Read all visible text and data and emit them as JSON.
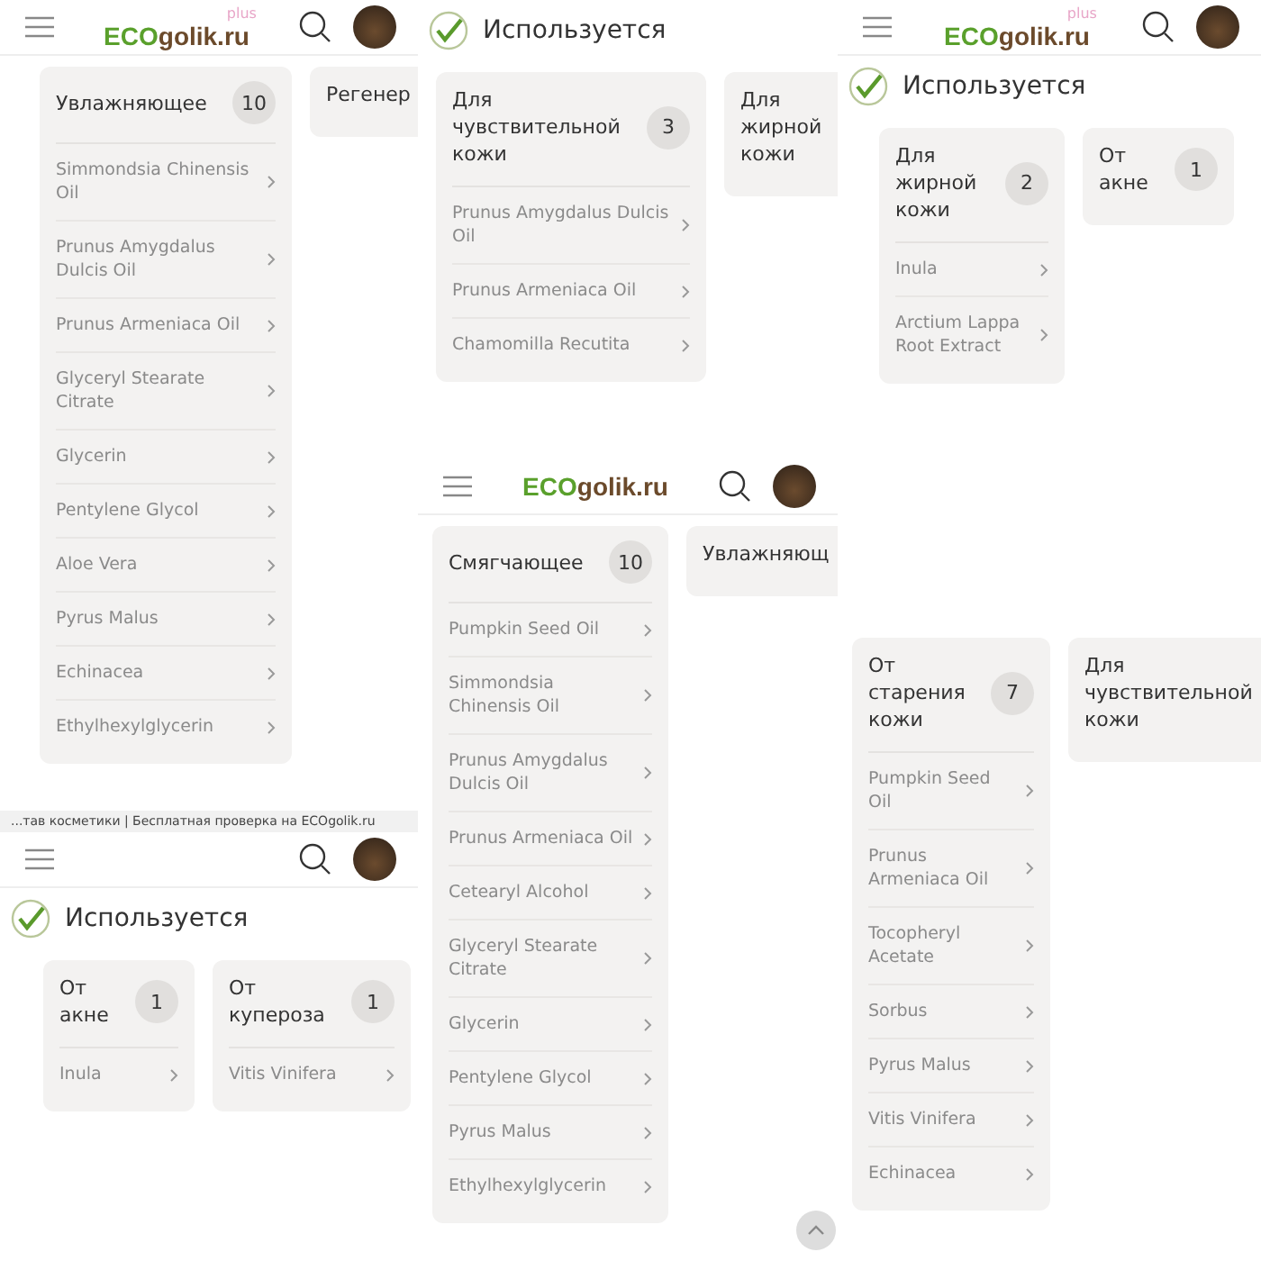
{
  "screenshots": [
    {
      "header": {
        "logo_main": "ECO",
        "logo_domain": "golik.ru",
        "logo_badge": "plus"
      },
      "cards": [
        {
          "title": "Увлажняющее",
          "count": "10",
          "items": [
            "Simmondsia Chinensis Oil",
            "Prunus Amygdalus Dulcis Oil",
            "Prunus Armeniaca Oil",
            "Glyceryl Stearate Citrate",
            "Glycerin",
            "Pentylene Glycol",
            "Aloe Vera",
            "Pyrus Malus",
            "Echinacea",
            "Ethylhexylglycerin"
          ]
        },
        {
          "title": "Регенер"
        }
      ]
    },
    {
      "used_label": "Используется",
      "cards": [
        {
          "title": "Для чувствительной кожи",
          "count": "3",
          "items": [
            "Prunus Amygdalus Dulcis Oil",
            "Prunus Armeniaca Oil",
            "Chamomilla Recutita"
          ]
        },
        {
          "title": "Для жирной кожи"
        }
      ]
    },
    {
      "header": {
        "logo_main": "ECO",
        "logo_domain": "golik.ru",
        "logo_badge": "plus"
      },
      "used_label": "Используется",
      "cards": [
        {
          "title": "Для жирной кожи",
          "count": "2",
          "items": [
            "Inula",
            "Arctium Lappa Root Extract"
          ]
        },
        {
          "title": "От акне",
          "count": "1"
        }
      ]
    },
    {
      "cards": [
        {
          "title": "От старения кожи",
          "count": "7",
          "items": [
            "Pumpkin Seed Oil",
            "Prunus Armeniaca Oil",
            "Tocopheryl Acetate",
            "Sorbus",
            "Pyrus Malus",
            "Vitis Vinifera",
            "Echinacea"
          ]
        },
        {
          "title": "Для чувствительной кожи"
        }
      ]
    },
    {
      "caption": "...тав косметики | Бесплатная проверка на ECOgolik.ru",
      "show_header": true,
      "used_label": "Используется",
      "cards": [
        {
          "title": "От акне",
          "count": "1",
          "items": [
            "Inula"
          ]
        },
        {
          "title": "От купероза",
          "count": "1",
          "items": [
            "Vitis Vinifera"
          ]
        }
      ]
    },
    {
      "header": {
        "logo_main": "ECO",
        "logo_domain": "golik.ru"
      },
      "cards": [
        {
          "title": "Смягчающее",
          "count": "10",
          "items": [
            "Pumpkin Seed Oil",
            "Simmondsia Chinensis Oil",
            "Prunus Amygdalus Dulcis Oil",
            "Prunus Armeniaca Oil",
            "Cetearyl Alcohol",
            "Glyceryl Stearate Citrate",
            "Glycerin",
            "Pentylene Glycol",
            "Pyrus Malus",
            "Ethylhexylglycerin"
          ]
        },
        {
          "title": "Увлажняющ"
        }
      ]
    }
  ]
}
